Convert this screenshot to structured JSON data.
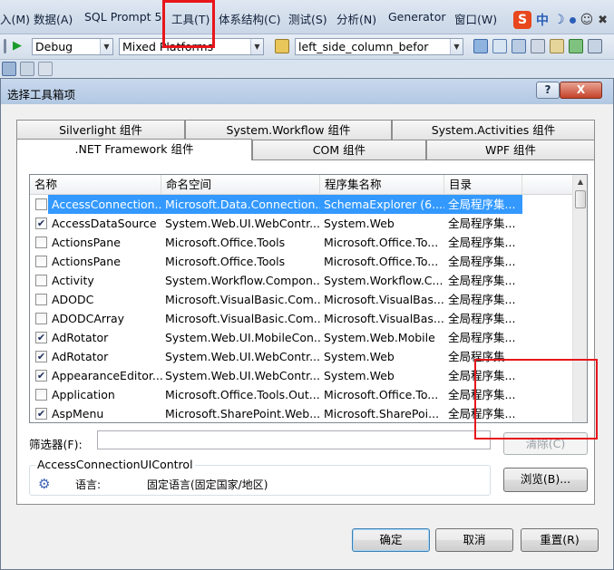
{
  "menubar": {
    "items": [
      "入(M)",
      "数据(A)",
      "SQL Prompt 5",
      "工具(T)",
      "体系结构(C)",
      "测试(S)",
      "分析(N)",
      "Generator",
      "窗口(W)"
    ],
    "tray": {
      "s_logo": "S",
      "zhong": "中"
    }
  },
  "toolbar": {
    "config": "Debug",
    "platform": "Mixed Platforms",
    "target": "left_side_column_befor"
  },
  "dialog": {
    "title": "选择工具箱项",
    "help": "?",
    "close": "X",
    "tabs_back": [
      "Silverlight 组件",
      "System.Workflow 组件",
      "System.Activities 组件"
    ],
    "tabs_front": [
      ".NET Framework 组件",
      "COM 组件",
      "WPF 组件"
    ],
    "columns": [
      "名称",
      "命名空间",
      "程序集名称",
      "目录"
    ],
    "rows": [
      {
        "checked": false,
        "name": "AccessConnection...",
        "namespace": "Microsoft.Data.Connection...",
        "assembly": "SchemaExplorer (6....",
        "dir": "全局程序集...",
        "selected": true
      },
      {
        "checked": true,
        "name": "AccessDataSource",
        "namespace": "System.Web.UI.WebContr...",
        "assembly": "System.Web",
        "dir": "全局程序集..."
      },
      {
        "checked": false,
        "name": "ActionsPane",
        "namespace": "Microsoft.Office.Tools",
        "assembly": "Microsoft.Office.To...",
        "dir": "全局程序集..."
      },
      {
        "checked": false,
        "name": "ActionsPane",
        "namespace": "Microsoft.Office.Tools",
        "assembly": "Microsoft.Office.To...",
        "dir": "全局程序集..."
      },
      {
        "checked": false,
        "name": "Activity",
        "namespace": "System.Workflow.Compon...",
        "assembly": "System.Workflow.C...",
        "dir": "全局程序集..."
      },
      {
        "checked": false,
        "name": "ADODC",
        "namespace": "Microsoft.VisualBasic.Com...",
        "assembly": "Microsoft.VisualBas...",
        "dir": "全局程序集..."
      },
      {
        "checked": false,
        "name": "ADODCArray",
        "namespace": "Microsoft.VisualBasic.Com...",
        "assembly": "Microsoft.VisualBas...",
        "dir": "全局程序集..."
      },
      {
        "checked": true,
        "name": "AdRotator",
        "namespace": "System.Web.UI.MobileCon...",
        "assembly": "System.Web.Mobile",
        "dir": "全局程序集..."
      },
      {
        "checked": true,
        "name": "AdRotator",
        "namespace": "System.Web.UI.WebContr...",
        "assembly": "System.Web",
        "dir": "全局程序集..."
      },
      {
        "checked": true,
        "name": "AppearanceEditor...",
        "namespace": "System.Web.UI.WebContr...",
        "assembly": "System.Web",
        "dir": "全局程序集..."
      },
      {
        "checked": false,
        "name": "Application",
        "namespace": "Microsoft.Office.Tools.Out...",
        "assembly": "Microsoft.Office.To...",
        "dir": "全局程序集..."
      },
      {
        "checked": true,
        "name": "AspMenu",
        "namespace": "Microsoft.SharePoint.Web...",
        "assembly": "Microsoft.SharePoi...",
        "dir": "全局程序集..."
      }
    ],
    "filter_label": "筛选器(F):",
    "filter_value": "",
    "clear_label": "清除(C)",
    "info_title": "AccessConnectionUIControl",
    "language_label": "语言:",
    "language_value": "固定语言(固定国家/地区)",
    "browse_label": "浏览(B)...",
    "ok_label": "确定",
    "cancel_label": "取消",
    "reset_label": "重置(R)"
  },
  "colors": {
    "selection": "#3399ff",
    "highlight_box": "#e8151b"
  }
}
